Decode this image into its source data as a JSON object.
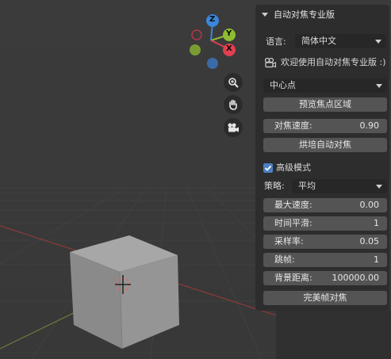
{
  "viewport": {
    "gizmo": {
      "z": "Z",
      "y": "Y",
      "x": "X"
    },
    "nav_icons": [
      "zoom-icon",
      "hand-icon",
      "camera-icon"
    ]
  },
  "panel": {
    "title": "自动对焦专业版",
    "language_label": "语言:",
    "language_value": "简体中文",
    "welcome": "欢迎使用自动对焦专业版 :)",
    "focus_mode": "中心点",
    "preview_button": "预览焦点区域",
    "speed": {
      "label": "对焦速度:",
      "value": "0.90"
    },
    "bake_button": "烘培自动对焦",
    "advanced_label": "高级模式",
    "advanced_checked": true,
    "strategy_label": "策略:",
    "strategy_value": "平均",
    "max_speed": {
      "label": "最大速度:",
      "value": "0.00"
    },
    "smoothing": {
      "label": "时间平滑:",
      "value": "1"
    },
    "sample_rate": {
      "label": "采样率:",
      "value": "0.05"
    },
    "frame_skip": {
      "label": "跳帧:",
      "value": "1"
    },
    "bg_distance": {
      "label": "背景距离:",
      "value": "100000.00"
    },
    "perfect_button": "完美帧对焦"
  },
  "colors": {
    "panel_bg": "#2d2d2d",
    "button": "#545454",
    "accent": "#4a7fc1",
    "axis_x": "#e0404f",
    "axis_y": "#8dbd30",
    "axis_z": "#3b86d9"
  }
}
